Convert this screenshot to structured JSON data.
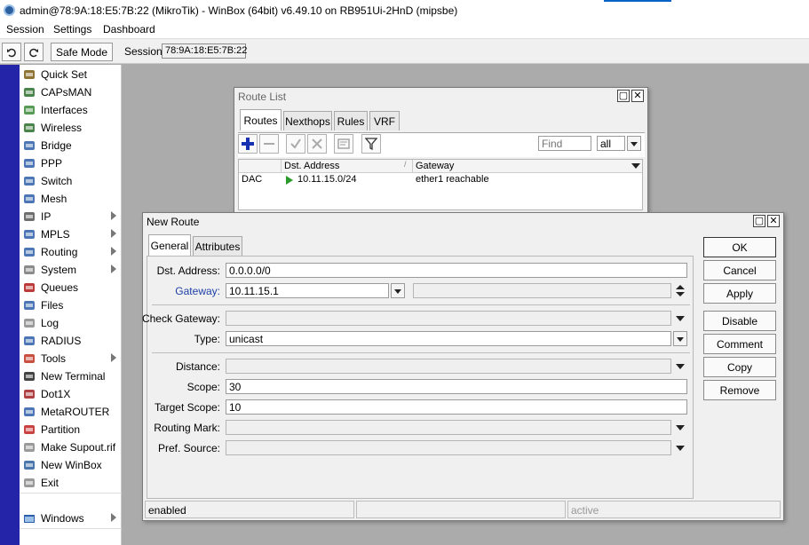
{
  "window": {
    "title": "admin@78:9A:18:E5:7B:22 (MikroTik) - WinBox (64bit) v6.49.10 on RB951Ui-2HnD (mipsbe)"
  },
  "menu": {
    "session": "Session",
    "settings": "Settings",
    "dashboard": "Dashboard"
  },
  "toolbar": {
    "safe_mode": "Safe Mode",
    "session_label": "Session:",
    "session_value": "78:9A:18:E5:7B:22"
  },
  "sidebar": {
    "items": [
      {
        "label": "Quick Set",
        "icon": "wand-icon"
      },
      {
        "label": "CAPsMAN",
        "icon": "antenna-icon"
      },
      {
        "label": "Interfaces",
        "icon": "interfaces-icon"
      },
      {
        "label": "Wireless",
        "icon": "wireless-icon"
      },
      {
        "label": "Bridge",
        "icon": "bridge-icon"
      },
      {
        "label": "PPP",
        "icon": "ppp-icon"
      },
      {
        "label": "Switch",
        "icon": "switch-icon"
      },
      {
        "label": "Mesh",
        "icon": "mesh-icon"
      },
      {
        "label": "IP",
        "icon": "ip-icon",
        "submenu": true
      },
      {
        "label": "MPLS",
        "icon": "mpls-icon",
        "submenu": true
      },
      {
        "label": "Routing",
        "icon": "routing-icon",
        "submenu": true
      },
      {
        "label": "System",
        "icon": "gear-icon",
        "submenu": true
      },
      {
        "label": "Queues",
        "icon": "queues-icon"
      },
      {
        "label": "Files",
        "icon": "folder-icon"
      },
      {
        "label": "Log",
        "icon": "log-icon"
      },
      {
        "label": "RADIUS",
        "icon": "radius-icon"
      },
      {
        "label": "Tools",
        "icon": "tools-icon",
        "submenu": true
      },
      {
        "label": "New Terminal",
        "icon": "terminal-icon"
      },
      {
        "label": "Dot1X",
        "icon": "dot1x-icon"
      },
      {
        "label": "MetaROUTER",
        "icon": "metarouter-icon"
      },
      {
        "label": "Partition",
        "icon": "partition-icon"
      },
      {
        "label": "Make Supout.rif",
        "icon": "supout-icon"
      },
      {
        "label": "New WinBox",
        "icon": "winbox-icon"
      },
      {
        "label": "Exit",
        "icon": "exit-icon"
      }
    ],
    "windows": "Windows"
  },
  "route_list": {
    "title": "Route List",
    "tabs": [
      "Routes",
      "Nexthops",
      "Rules",
      "VRF"
    ],
    "find_placeholder": "Find",
    "filter_value": "all",
    "columns": [
      "Dst. Address",
      "Gateway"
    ],
    "rows": [
      {
        "flags": "DAC",
        "dst": "10.11.15.0/24",
        "gateway": "ether1 reachable"
      }
    ]
  },
  "new_route": {
    "title": "New Route",
    "tabs": [
      "General",
      "Attributes"
    ],
    "labels": {
      "dst": "Dst. Address:",
      "gateway": "Gateway:",
      "check_gateway": "Check Gateway:",
      "type": "Type:",
      "distance": "Distance:",
      "scope": "Scope:",
      "target_scope": "Target Scope:",
      "routing_mark": "Routing Mark:",
      "pref_source": "Pref. Source:"
    },
    "values": {
      "dst": "0.0.0.0/0",
      "gateway": "10.11.15.1",
      "type": "unicast",
      "scope": "30",
      "target_scope": "10"
    },
    "buttons": [
      "OK",
      "Cancel",
      "Apply",
      "Disable",
      "Comment",
      "Copy",
      "Remove"
    ],
    "status": [
      "enabled",
      "",
      "active"
    ]
  },
  "colors": {
    "strip": "#2424a8",
    "link_label": "#1d3fa8",
    "add_icon": "#1530b0"
  }
}
